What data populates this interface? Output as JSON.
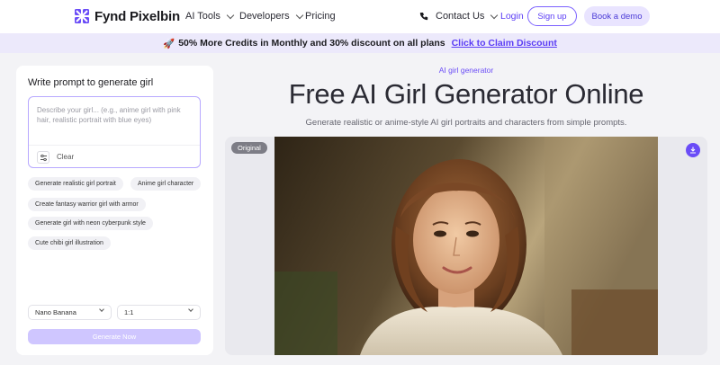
{
  "header": {
    "logo_text": "Fynd Pixelbin",
    "nav": [
      {
        "label": "AI Tools",
        "has_dropdown": true
      },
      {
        "label": "Developers",
        "has_dropdown": true
      },
      {
        "label": "Pricing",
        "has_dropdown": false
      }
    ],
    "contact_label": "Contact Us",
    "login_label": "Login",
    "signup_label": "Sign up",
    "demo_label": "Book a demo",
    "accent_color": "#6a4cf7"
  },
  "promo": {
    "emoji": "🚀",
    "text": "50% More Credits in Monthly and 30% discount on all plans",
    "link_label": "Click to Claim Discount"
  },
  "panel": {
    "title": "Write prompt to generate girl",
    "prompt_placeholder": "Describe your girl... (e.g., anime girl with pink hair, realistic portrait with blue eyes)",
    "clear_label": "Clear",
    "suggestions": [
      "Generate realistic girl portrait",
      "Anime girl character",
      "Create fantasy warrior girl with armor",
      "Generate girl with neon cyberpunk style",
      "Cute chibi girl illustration"
    ],
    "model_select": "Nano Banana",
    "ratio_select": "1:1",
    "generate_label": "Generate Now"
  },
  "main": {
    "eyebrow": "AI girl generator",
    "headline": "Free AI Girl Generator Online",
    "subhead": "Generate realistic or anime-style AI girl portraits and characters from simple prompts.",
    "badge_label": "Original"
  }
}
